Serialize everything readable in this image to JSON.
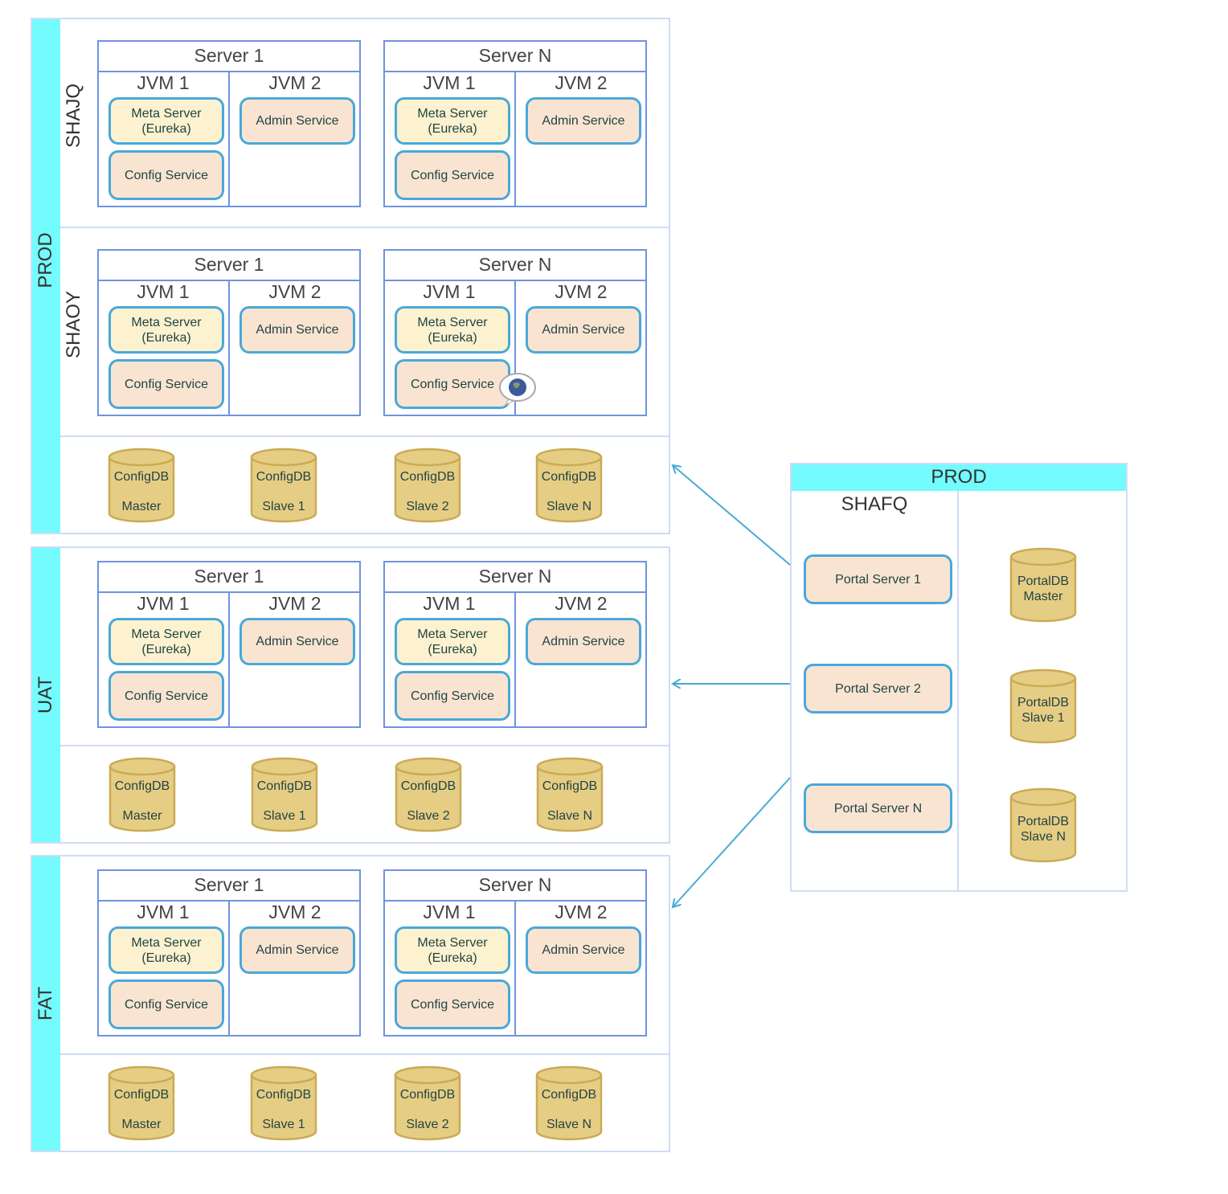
{
  "environments": [
    {
      "name": "PROD",
      "clusters": [
        {
          "name": "SHAJQ",
          "servers": [
            {
              "title": "Server 1"
            },
            {
              "title": "Server N"
            }
          ]
        },
        {
          "name": "SHAOY",
          "servers": [
            {
              "title": "Server 1"
            },
            {
              "title": "Server N",
              "config_badge_icon": "globe-icon"
            }
          ]
        }
      ],
      "dbs": [
        [
          "ConfigDB",
          "Master"
        ],
        [
          "ConfigDB",
          "Slave 1"
        ],
        [
          "ConfigDB",
          "Slave 2"
        ],
        [
          "ConfigDB",
          "Slave N"
        ]
      ]
    },
    {
      "name": "UAT",
      "clusters": [
        {
          "name": "",
          "servers": [
            {
              "title": "Server 1"
            },
            {
              "title": "Server N"
            }
          ]
        }
      ],
      "dbs": [
        [
          "ConfigDB",
          "Master"
        ],
        [
          "ConfigDB",
          "Slave 1"
        ],
        [
          "ConfigDB",
          "Slave 2"
        ],
        [
          "ConfigDB",
          "Slave N"
        ]
      ]
    },
    {
      "name": "FAT",
      "clusters": [
        {
          "name": "",
          "servers": [
            {
              "title": "Server 1"
            },
            {
              "title": "Server N"
            }
          ]
        }
      ],
      "dbs": [
        [
          "ConfigDB",
          "Master"
        ],
        [
          "ConfigDB",
          "Slave 1"
        ],
        [
          "ConfigDB",
          "Slave 2"
        ],
        [
          "ConfigDB",
          "Slave N"
        ]
      ]
    }
  ],
  "server_template": {
    "jvm1": "JVM 1",
    "jvm2": "JVM 2",
    "meta": "Meta Server\n(Eureka)",
    "config": "Config Service",
    "admin": "Admin Service"
  },
  "portal": {
    "env": "PROD",
    "cluster": "SHAFQ",
    "servers": [
      "Portal Server 1",
      "Portal Server 2",
      "Portal Server N"
    ],
    "dbs": [
      [
        "PortalDB",
        "Master"
      ],
      [
        "PortalDB",
        "Slave 1"
      ],
      [
        "PortalDB",
        "Slave N"
      ]
    ]
  },
  "colors": {
    "env_stripe": "#73fbfd",
    "server_border": "#6f93e0",
    "service_border": "#4aa8d8",
    "meta_fill": "#fcf2cf",
    "service_fill": "#f9e4d2",
    "db_fill": "#e6cd84",
    "arrow": "#4aa8d8"
  }
}
